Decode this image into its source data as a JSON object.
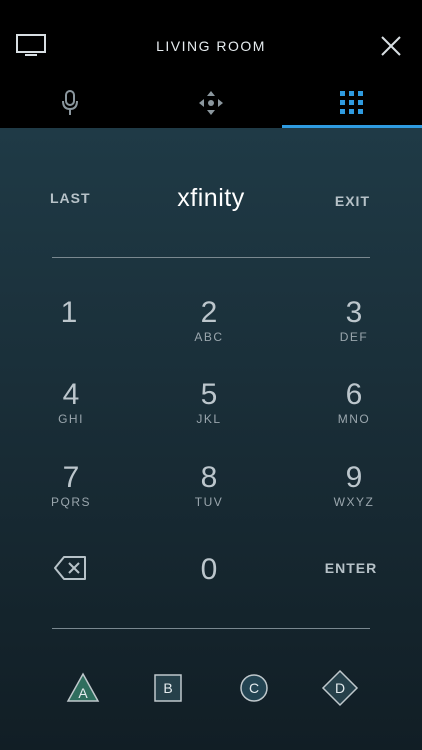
{
  "header": {
    "title": "LIVING ROOM",
    "icons": [
      "tv-icon",
      "close-icon"
    ]
  },
  "tabs": [
    {
      "name": "voice",
      "icon": "microphone-icon",
      "active": false
    },
    {
      "name": "navigation",
      "icon": "dpad-icon",
      "active": false
    },
    {
      "name": "keypad",
      "icon": "keypad-icon",
      "active": true
    }
  ],
  "controls": {
    "last_label": "LAST",
    "logo_text": "xfinity",
    "exit_label": "EXIT",
    "enter_label": "ENTER",
    "backspace_icon": "backspace-icon"
  },
  "keypad": [
    {
      "num": "1",
      "letters": ""
    },
    {
      "num": "2",
      "letters": "ABC"
    },
    {
      "num": "3",
      "letters": "DEF"
    },
    {
      "num": "4",
      "letters": "GHI"
    },
    {
      "num": "5",
      "letters": "JKL"
    },
    {
      "num": "6",
      "letters": "MNO"
    },
    {
      "num": "7",
      "letters": "PQRS"
    },
    {
      "num": "8",
      "letters": "TUV"
    },
    {
      "num": "9",
      "letters": "WXYZ"
    },
    {
      "num": "0",
      "letters": ""
    }
  ],
  "color_buttons": [
    {
      "label": "A",
      "shape": "triangle",
      "color": "#2f6e5e"
    },
    {
      "label": "B",
      "shape": "square",
      "color": "#26404a"
    },
    {
      "label": "C",
      "shape": "circle",
      "color": "#234452"
    },
    {
      "label": "D",
      "shape": "diamond",
      "color": "#26404a"
    }
  ],
  "colors": {
    "accent": "#2f9be0",
    "background_top": "#1f3a46",
    "background_bottom": "#111e25"
  }
}
